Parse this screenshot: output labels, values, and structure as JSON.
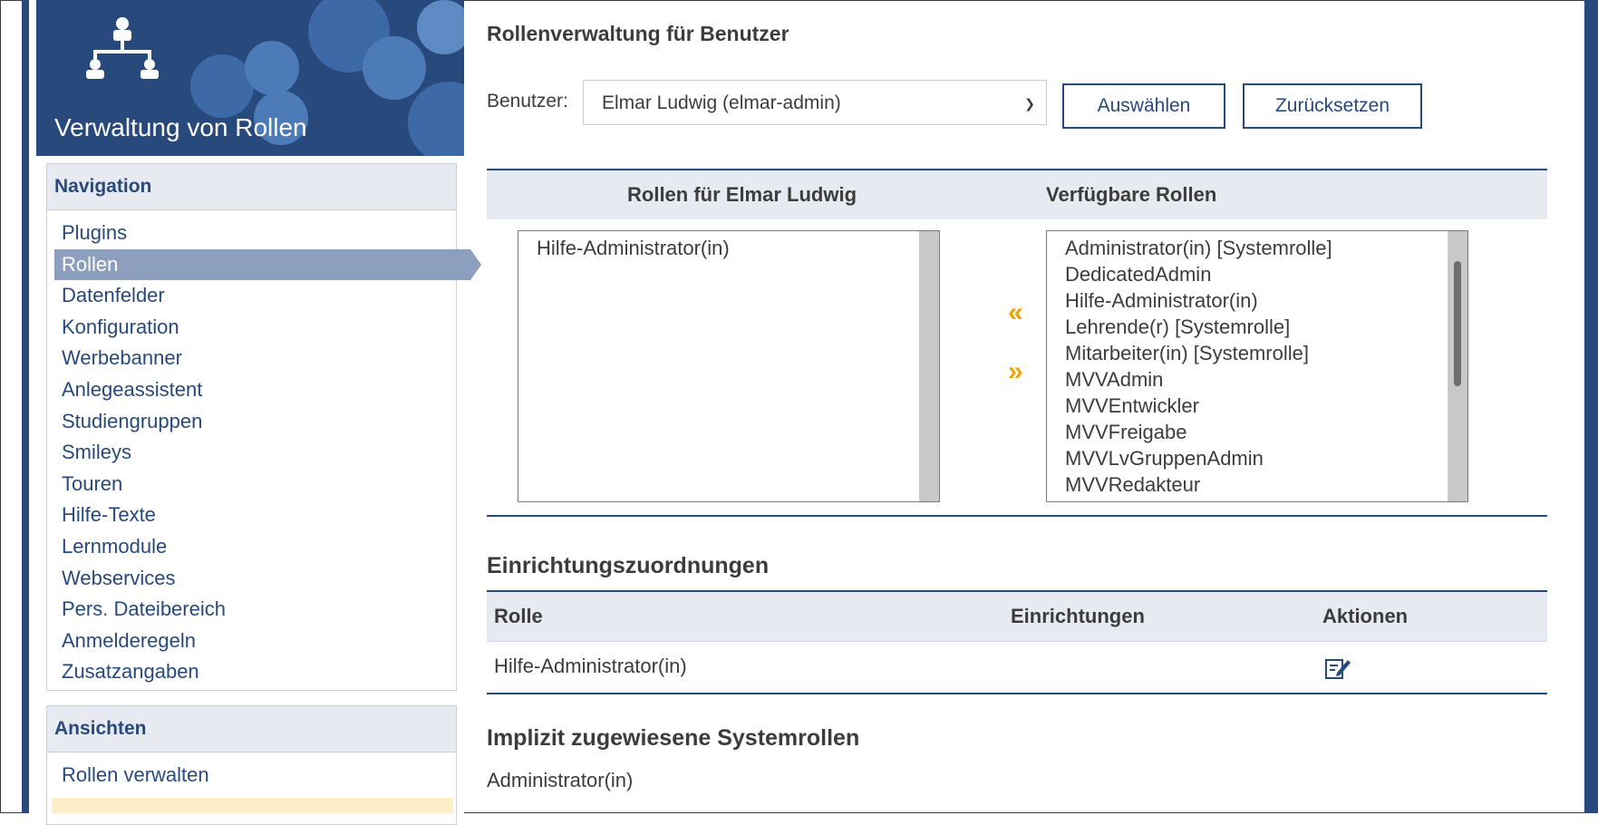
{
  "sidebar": {
    "title": "Verwaltung von Rollen",
    "nav_title": "Navigation",
    "nav_items": [
      "Plugins",
      "Rollen",
      "Datenfelder",
      "Konfiguration",
      "Werbebanner",
      "Anlegeassistent",
      "Studiengruppen",
      "Smileys",
      "Touren",
      "Hilfe-Texte",
      "Lernmodule",
      "Webservices",
      "Pers. Dateibereich",
      "Anmelderegeln",
      "Zusatzangaben"
    ],
    "active_nav": "Rollen",
    "views_title": "Ansichten",
    "views_items": [
      "Rollen verwalten"
    ]
  },
  "main": {
    "title": "Rollenverwaltung für Benutzer",
    "user_label": "Benutzer:",
    "user_select_value": "Elmar Ludwig (elmar-admin)",
    "select_button": "Auswählen",
    "reset_button": "Zurücksetzen",
    "assigned_header": "Rollen für Elmar Ludwig",
    "available_header": "Verfügbare Rollen",
    "assigned_roles": [
      "Hilfe-Administrator(in)"
    ],
    "available_roles": [
      "Administrator(in) [Systemrolle]",
      "DedicatedAdmin",
      "Hilfe-Administrator(in)",
      "Lehrende(r) [Systemrolle]",
      "Mitarbeiter(in) [Systemrolle]",
      "MVVAdmin",
      "MVVEntwickler",
      "MVVFreigabe",
      "MVVLvGruppenAdmin",
      "MVVRedakteur"
    ],
    "move_left": "«",
    "move_right": "»",
    "institutions_title": "Einrichtungszuordnungen",
    "inst_columns": [
      "Rolle",
      "Einrichtungen",
      "Aktionen"
    ],
    "inst_rows": [
      {
        "role": "Hilfe-Administrator(in)",
        "institutions": ""
      }
    ],
    "implicit_title": "Implizit zugewiesene Systemrollen",
    "implicit_roles": [
      "Administrator(in)"
    ]
  },
  "colors": {
    "brand": "#28497c",
    "accent": "#f2a100",
    "active_nav": "#8c9fbe"
  }
}
